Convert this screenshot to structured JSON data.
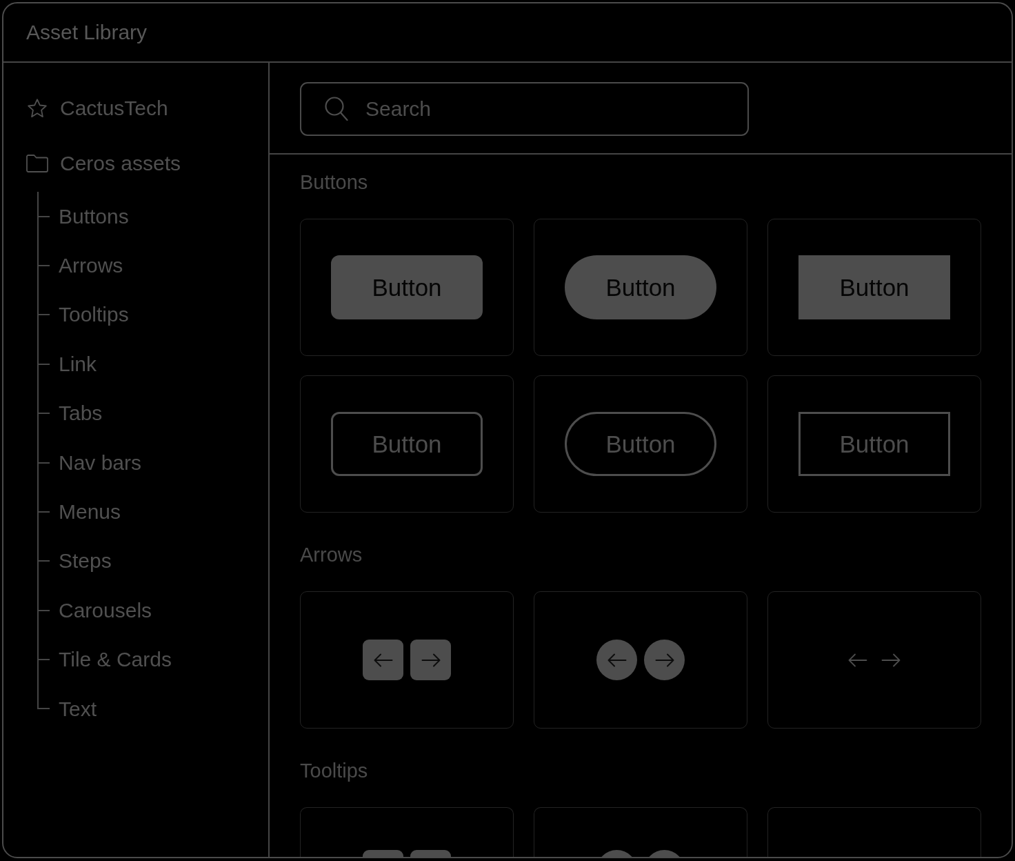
{
  "window": {
    "title": "Asset Library"
  },
  "sidebar": {
    "items": [
      {
        "kind": "favorite",
        "label": "CactusTech"
      },
      {
        "kind": "folder",
        "label": "Ceros assets",
        "children": [
          {
            "label": "Buttons"
          },
          {
            "label": "Arrows"
          },
          {
            "label": "Tooltips"
          },
          {
            "label": "Link"
          },
          {
            "label": "Tabs"
          },
          {
            "label": "Nav bars"
          },
          {
            "label": "Menus"
          },
          {
            "label": "Steps"
          },
          {
            "label": "Carousels"
          },
          {
            "label": "Tile & Cards"
          },
          {
            "label": "Text"
          }
        ]
      }
    ]
  },
  "search": {
    "placeholder": "Search"
  },
  "sections": [
    {
      "title": "Buttons",
      "cards": [
        {
          "kind": "solid-rounded",
          "label": "Button"
        },
        {
          "kind": "solid-pill",
          "label": "Button"
        },
        {
          "kind": "solid-square",
          "label": "Button"
        },
        {
          "kind": "outline-rounded",
          "label": "Button"
        },
        {
          "kind": "outline-pill",
          "label": "Button"
        },
        {
          "kind": "outline-square",
          "label": "Button"
        }
      ]
    },
    {
      "title": "Arrows",
      "cards": [
        {
          "kind": "square-arrows"
        },
        {
          "kind": "round-arrows"
        },
        {
          "kind": "plain-arrows"
        }
      ]
    },
    {
      "title": "Tooltips",
      "cards": [
        {
          "kind": "square-tiles"
        },
        {
          "kind": "round-tiles"
        },
        {
          "kind": "blank"
        }
      ]
    }
  ]
}
